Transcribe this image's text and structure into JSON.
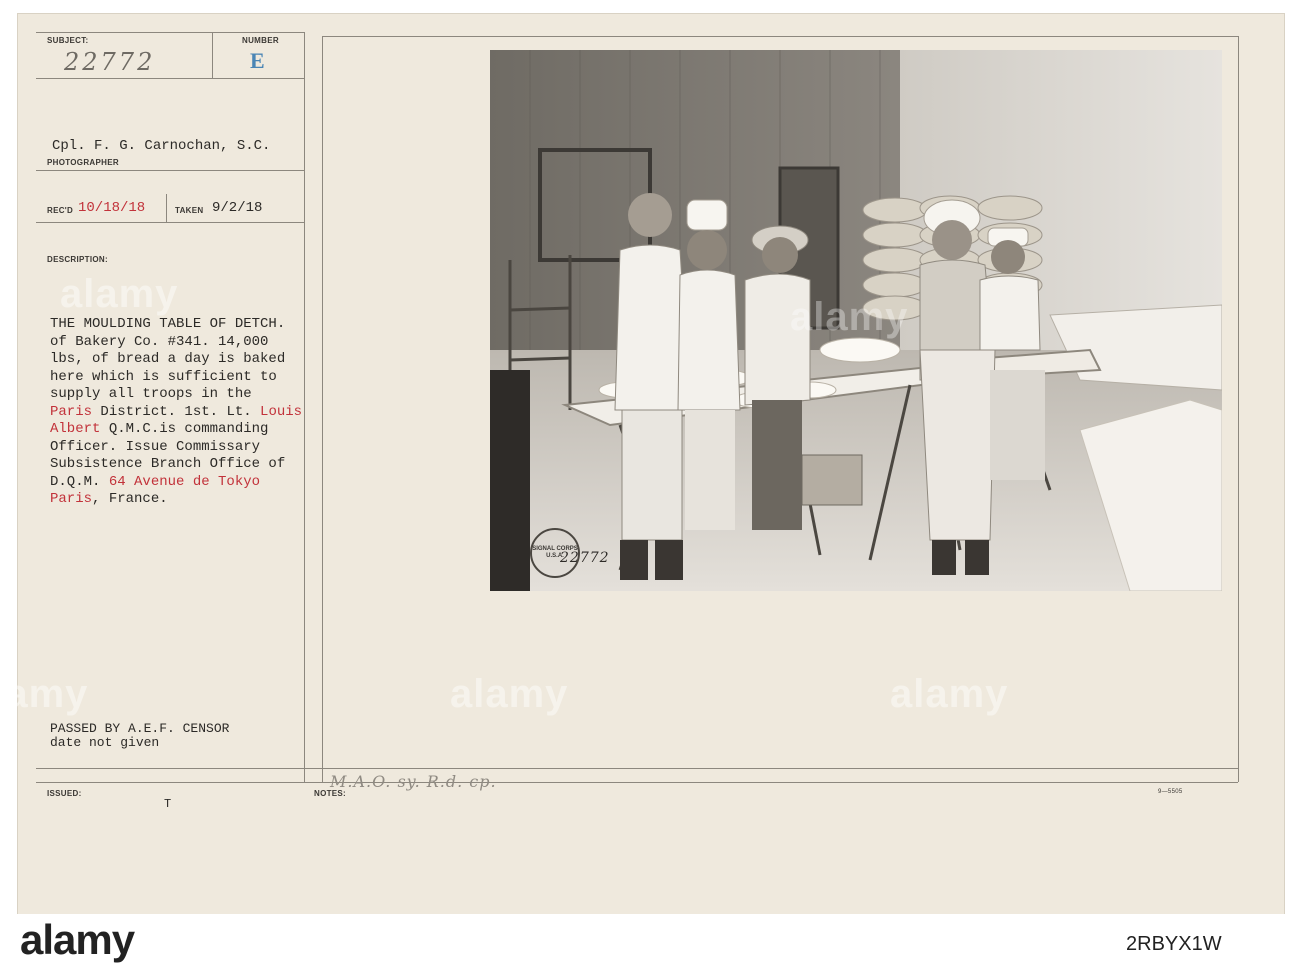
{
  "card": {
    "subject_label": "SUBJECT:",
    "subject_value": "22772",
    "number_label": "NUMBER",
    "number_value": "E",
    "photographer_value": "Cpl. F. G. Carnochan, S.C.",
    "photographer_label": "PHOTOGRAPHER",
    "recd_label": "REC'D",
    "recd_value": "10/18/18",
    "taken_label": "TAKEN",
    "taken_value": "9/2/18",
    "description_label": "DESCRIPTION:",
    "description_lines": [
      "THE MOULDING TABLE OF DETCH.",
      "of Bakery Co. #341. 14,000",
      "lbs, of bread a day is baked",
      "here which is sufficient to",
      "supply all troops in the"
    ],
    "line6_red": "Paris",
    "line6_black": " District. 1st. Lt. ",
    "line6_red2": "Louis",
    "line7_red": "Albert",
    "line7_black": " Q.M.C.is commanding",
    "line8": "Officer. Issue Commissary",
    "line9": "Subsistence Branch Office of",
    "line10_black": "D.Q.M. ",
    "line10_red": "64 Avenue de Tokyo",
    "line11_red": "Paris",
    "line11_black": ", France.",
    "censor_line1": "PASSED BY A.E.F. CENSOR",
    "censor_line2": "date not given",
    "issued_label": "ISSUED:",
    "issued_value": "T",
    "notes_label": "NOTES:",
    "notes_value": "M.A.O. sy. R.d. cp.",
    "form_number": "9—5505",
    "photo_negative_number": "22772",
    "photo_stamp_text": "SIGNAL CORPS U.S.A."
  },
  "watermark": {
    "text": "alamy"
  },
  "footer": {
    "brand": "alamy",
    "image_id": "2RBYX1W"
  },
  "colors": {
    "card": "#efe9dd",
    "red_type": "#c2323a",
    "blue_stamp": "#4a85b5"
  }
}
